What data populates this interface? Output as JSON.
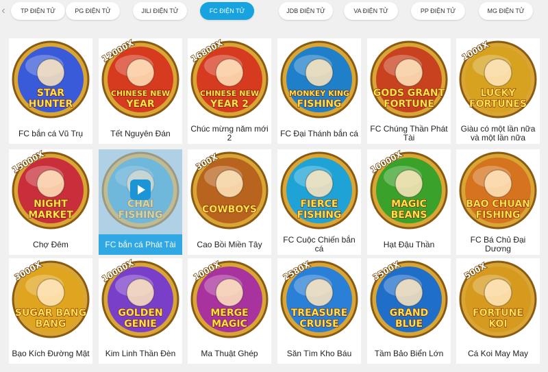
{
  "tabs": [
    {
      "label": "TP ĐIỆN TỬ"
    },
    {
      "label": "PG ĐIỆN TỬ"
    },
    {
      "label": "JILI ĐIỆN TỬ"
    },
    {
      "label": "FC ĐIỆN TỬ"
    },
    {
      "label": "JDB ĐIỆN TỬ"
    },
    {
      "label": "VA ĐIỆN TỬ"
    },
    {
      "label": "PP ĐIỆN TỬ"
    },
    {
      "label": "MG ĐIỆN TỬ"
    }
  ],
  "active_tab": "FC ĐIỆN TỬ",
  "colors": {
    "accent": "#16a3e0",
    "active_card": "#2fa8e4"
  },
  "games": [
    {
      "title": "FC bắn cá Vũ Trụ",
      "logo": "STAR HUNTER",
      "badge": "",
      "theme": "#3a5bd9"
    },
    {
      "title": "Tết Nguyên Đán",
      "logo": "CHINESE NEW YEAR",
      "badge": "12000X",
      "theme": "#d63a1f"
    },
    {
      "title": "Chúc mừng năm mới 2",
      "logo": "CHINESE NEW YEAR 2",
      "badge": "16800X",
      "theme": "#d63a1f"
    },
    {
      "title": "FC Đại Thánh bắn cá",
      "logo": "MONKEY KING FISHING",
      "badge": "",
      "theme": "#1f7fc9"
    },
    {
      "title": "FC Chúng Thần Phát Tài",
      "logo": "GODS GRANT FORTUNE",
      "badge": "",
      "theme": "#c9421f"
    },
    {
      "title": "Giàu có một lần nữa và một lần nữa",
      "logo": "LUCKY FORTUNES",
      "badge": "1000X",
      "theme": "#d6a21f"
    },
    {
      "title": "Chợ Đêm",
      "logo": "NIGHT MARKET",
      "badge": "15000X",
      "theme": "#c92f3a"
    },
    {
      "title": "FC bắn cá Phát Tài",
      "logo": "CHAI FISHING",
      "badge": "",
      "theme": "#2a9bd6"
    },
    {
      "title": "Cao Bồi Miền Tây",
      "logo": "COWBOYS",
      "badge": "300X",
      "theme": "#b8641f"
    },
    {
      "title": "FC Cuộc Chiến bắn cá",
      "logo": "FIERCE FISHING",
      "badge": "",
      "theme": "#1fa3d6"
    },
    {
      "title": "Hạt Đậu Thần",
      "logo": "MAGIC BEANS",
      "badge": "10000X",
      "theme": "#3aa22a"
    },
    {
      "title": "FC Bá Chủ Đại Dương",
      "logo": "BAO CHUAN FISHING",
      "badge": "",
      "theme": "#d6731f"
    },
    {
      "title": "Bạo Kích Đường Mật",
      "logo": "SUGAR BANG BANG",
      "badge": "3000X",
      "theme": "#e0a51f"
    },
    {
      "title": "Kim Linh Thần Đèn",
      "logo": "GOLDEN GENIE",
      "badge": "10000X",
      "theme": "#7a3fc9"
    },
    {
      "title": "Ma Thuật Ghép",
      "logo": "MERGE MAGIC",
      "badge": "1000X",
      "theme": "#a8329e"
    },
    {
      "title": "Săn Tìm Kho Báu",
      "logo": "TREASURE CRUISE",
      "badge": "2580X",
      "theme": "#2a7fd6"
    },
    {
      "title": "Tầm Bảo Biển Lớn",
      "logo": "GRAND BLUE",
      "badge": "3500X",
      "theme": "#1f6fc9"
    },
    {
      "title": "Cá Koi May May",
      "logo": "FORTUNE KOI",
      "badge": "500X",
      "theme": "#d69a1f"
    }
  ]
}
